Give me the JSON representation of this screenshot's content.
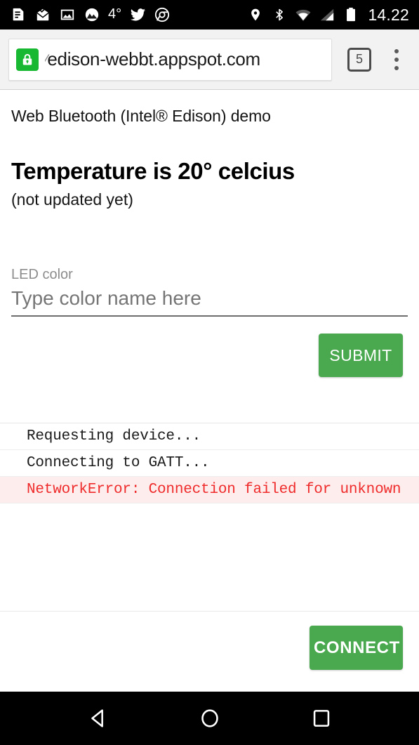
{
  "statusbar": {
    "icons_left": [
      {
        "name": "document-notification-icon",
        "glyph": "document"
      },
      {
        "name": "mail-open-check-icon",
        "glyph": "mail"
      },
      {
        "name": "photo-notification-icon",
        "glyph": "photo"
      },
      {
        "name": "weather-app-icon",
        "glyph": "weather"
      }
    ],
    "temperature": "4°",
    "icons_after_temp": [
      {
        "name": "twitter-icon",
        "glyph": "twitter"
      },
      {
        "name": "chrome-icon",
        "glyph": "chrome"
      }
    ],
    "icons_right": [
      {
        "name": "location-pin-icon",
        "glyph": "pin"
      },
      {
        "name": "bluetooth-icon",
        "glyph": "bluetooth"
      },
      {
        "name": "wifi-icon",
        "glyph": "wifi"
      },
      {
        "name": "cellular-signal-icon",
        "glyph": "signal"
      },
      {
        "name": "battery-icon",
        "glyph": "battery"
      }
    ],
    "clock": "14.22"
  },
  "browser": {
    "security_icon": "lock-icon",
    "url_clipped_prefix": "⁄",
    "url": "edison-webbt.appspot.com",
    "tab_count": "5",
    "menu_icon": "overflow-menu-icon"
  },
  "page": {
    "title": "Web Bluetooth (Intel® Edison) demo",
    "temperature_heading": "Temperature is 20° celcius",
    "temperature_status": "(not updated yet)",
    "form": {
      "label": "LED color",
      "placeholder": "Type color name here",
      "value": "",
      "submit_label": "SUBMIT"
    },
    "log": [
      {
        "text": "Requesting device...",
        "level": "info"
      },
      {
        "text": "Connecting to GATT...",
        "level": "info"
      },
      {
        "text": "NetworkError: Connection failed for unknown",
        "level": "error"
      }
    ],
    "connect_label": "CONNECT"
  },
  "navbar": {
    "back": "back-button",
    "home": "home-button",
    "recents": "recents-button"
  },
  "colors": {
    "accent_green": "#4aa94f",
    "lock_green": "#19b832",
    "error_red": "#ef2b2b",
    "error_bg": "#fdeded",
    "system_black": "#000000",
    "chrome_toolbar": "#f2f2f2"
  }
}
